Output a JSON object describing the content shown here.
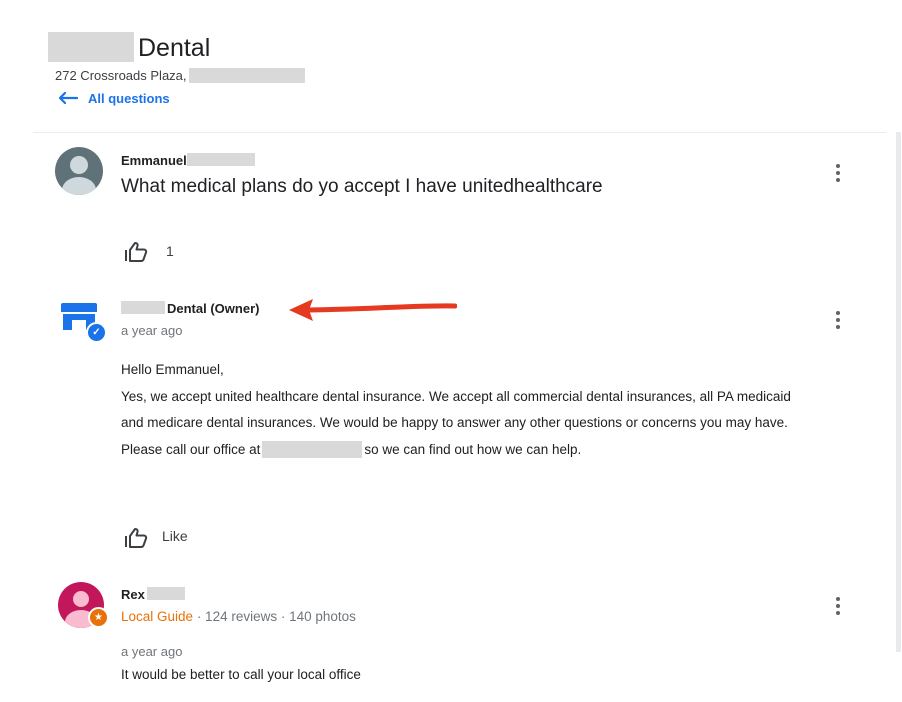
{
  "business": {
    "title": "Dental",
    "address": "272 Crossroads Plaza,"
  },
  "nav": {
    "back_label": "All questions"
  },
  "question": {
    "author": "Emmanuel",
    "text": "What medical plans do yo accept I have unitedhealthcare",
    "like_count": "1"
  },
  "owner_reply": {
    "author": "Dental (Owner)",
    "time": "a year ago",
    "greeting": "Hello Emmanuel,",
    "body_part1": "Yes, we accept united healthcare dental insurance. We accept all commercial dental insurances, all PA medicaid and medicare dental insurances. We would be happy to answer any other questions or concerns you may have. Please call our office at",
    "body_part2": "so we can find out how we can help.",
    "like_label": "Like"
  },
  "rex_answer": {
    "author": "Rex",
    "local_guide": "Local Guide",
    "stats": " · 124 reviews · 140 photos",
    "time": "a year ago",
    "text": "It would be better to call your local office"
  },
  "colors": {
    "link_blue": "#1a73e8",
    "annotation_red": "#e53920",
    "local_guide_orange": "#e8710a"
  },
  "icons": [
    "back-arrow-icon",
    "thumbs-up-icon",
    "more-vert-icon",
    "store-icon",
    "verified-badge-icon",
    "local-guide-badge-icon",
    "user-avatar-icon"
  ]
}
